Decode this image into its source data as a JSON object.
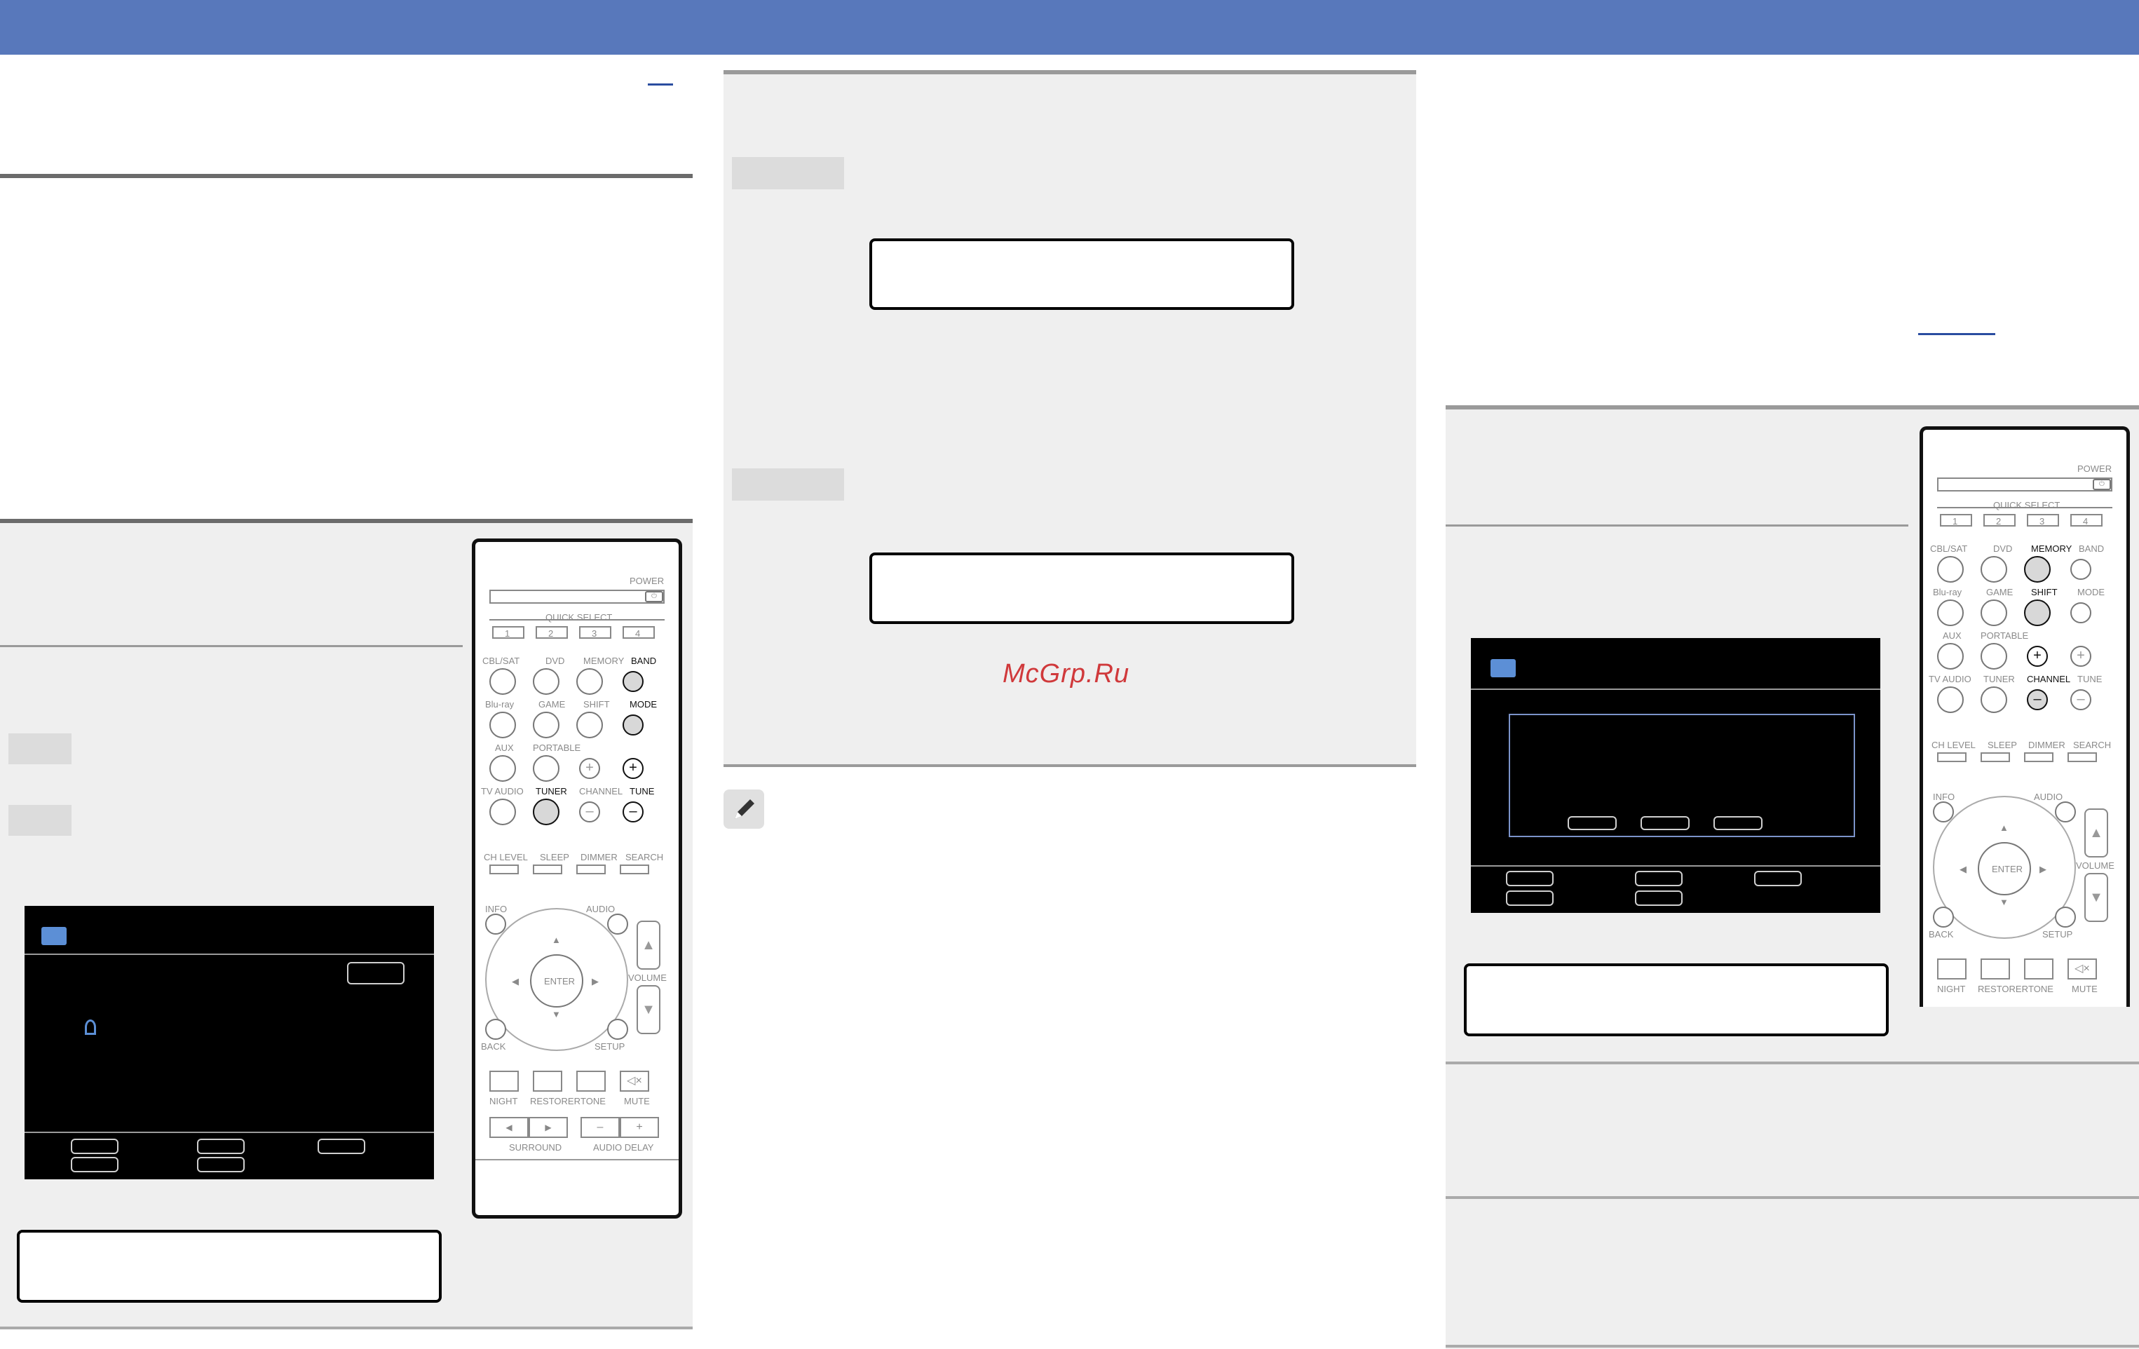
{
  "page": {
    "colors": {
      "header": "#5878bb",
      "panel": "#efefef",
      "rule": "#6b6b6b",
      "watermark": "#d0393b",
      "tv_icon": "#5c8fd6"
    },
    "watermark": "McGrp.Ru",
    "note_icon": "pencil-icon"
  },
  "remote": {
    "power": "POWER",
    "quick_select": "QUICK SELECT",
    "quick_nums": [
      "1",
      "2",
      "3",
      "4"
    ],
    "row1": [
      "CBL/SAT",
      "DVD",
      "MEMORY",
      "BAND"
    ],
    "row2": [
      "Blu-ray",
      "GAME",
      "SHIFT",
      "MODE"
    ],
    "row3": [
      "AUX",
      "PORTABLE"
    ],
    "row4": [
      "TV AUDIO",
      "TUNER",
      "CHANNEL",
      "TUNE"
    ],
    "row5": [
      "CH LEVEL",
      "SLEEP",
      "DIMMER",
      "SEARCH"
    ],
    "info": "INFO",
    "audio": "AUDIO",
    "enter": "ENTER",
    "volume": "VOLUME",
    "back": "BACK",
    "setup": "SETUP",
    "row6": [
      "NIGHT",
      "RESTORER",
      "TONE",
      "MUTE"
    ],
    "surround": "SURROUND",
    "audio_delay": "AUDIO DELAY",
    "plus": "+",
    "minus": "–"
  }
}
